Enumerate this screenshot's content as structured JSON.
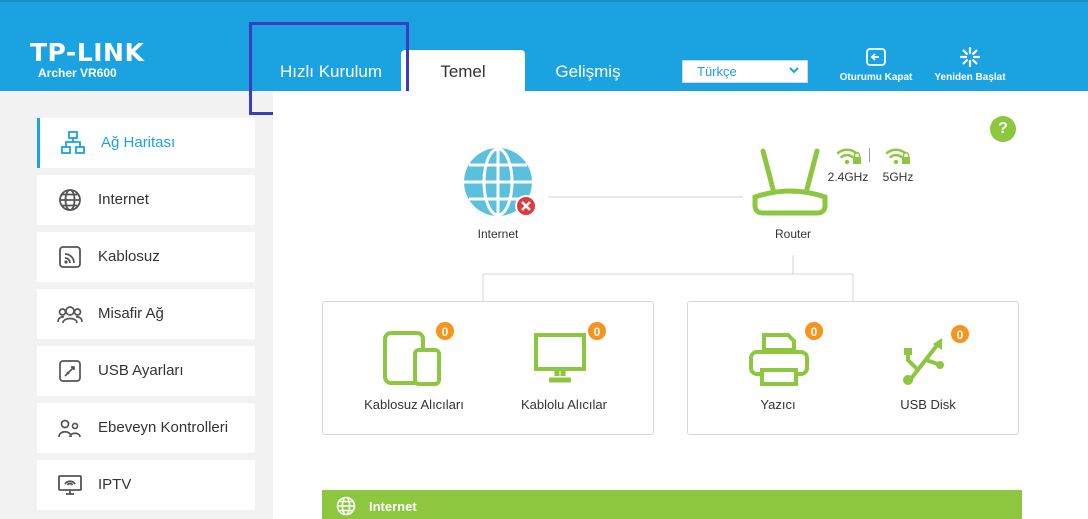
{
  "header": {
    "brand": "TP-LINK",
    "model": "Archer VR600",
    "tabs": {
      "quick_setup": "Hızlı Kurulum",
      "basic": "Temel",
      "advanced": "Gelişmiş"
    },
    "language": "Türkçe",
    "logout": "Oturumu Kapat",
    "reboot": "Yeniden Başlat"
  },
  "sidebar": {
    "items": [
      {
        "label": "Ağ Haritası",
        "icon": "network-map-icon",
        "active": true
      },
      {
        "label": "Internet",
        "icon": "globe-icon"
      },
      {
        "label": "Kablosuz",
        "icon": "wireless-icon"
      },
      {
        "label": "Misafir Ağ",
        "icon": "guest-network-icon"
      },
      {
        "label": "USB Ayarları",
        "icon": "usb-settings-icon"
      },
      {
        "label": "Ebeveyn Kontrolleri",
        "icon": "parental-controls-icon"
      },
      {
        "label": "IPTV",
        "icon": "iptv-icon"
      }
    ]
  },
  "map": {
    "internet_label": "Internet",
    "router_label": "Router",
    "band_24": "2.4GHz",
    "band_5": "5GHz",
    "help": "?",
    "devices": [
      {
        "label": "Kablosuz Alıcıları",
        "count": "0"
      },
      {
        "label": "Kablolu Alıcılar",
        "count": "0"
      },
      {
        "label": "Yazıcı",
        "count": "0"
      },
      {
        "label": "USB Disk",
        "count": "0"
      }
    ],
    "internet_section": "Internet"
  },
  "colors": {
    "header_blue": "#1aa3e0",
    "green": "#8dc63f",
    "badge_orange": "#f7941d",
    "error_red": "#e0393e"
  }
}
